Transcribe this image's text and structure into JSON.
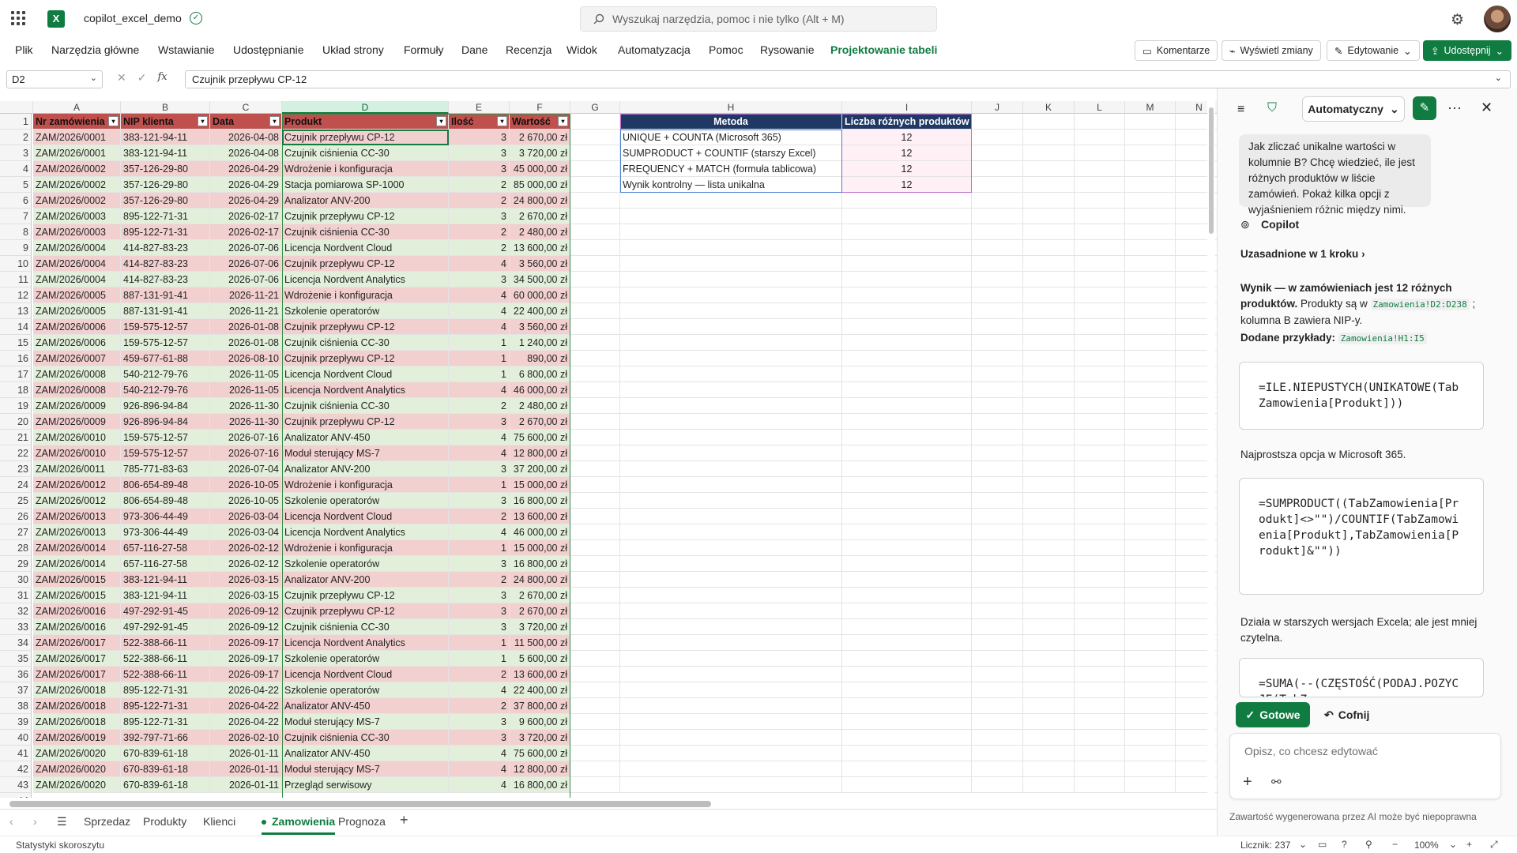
{
  "app": {
    "doc_title": "copilot_excel_demo",
    "search_placeholder": "Wyszukaj narzędzia, pomoc i nie tylko (Alt + M)"
  },
  "menu": [
    "Plik",
    "Narzędzia główne",
    "Wstawianie",
    "Udostępnianie",
    "Układ strony",
    "Formuły",
    "Dane",
    "Recenzja",
    "Widok",
    "Automatyzacja",
    "Pomoc",
    "Rysowanie",
    "Projektowanie tabeli"
  ],
  "ribbon_buttons": {
    "comments": "Komentarze",
    "changes": "Wyświetl zmiany",
    "editing": "Edytowanie",
    "share": "Udostępnij"
  },
  "formula_bar": {
    "name_box": "D2",
    "formula": "Czujnik przepływu CP-12"
  },
  "columns": [
    "A",
    "B",
    "C",
    "D",
    "E",
    "F",
    "G",
    "H",
    "I",
    "J",
    "K",
    "L",
    "M",
    "N"
  ],
  "table_headers": [
    "Nr zamówienia",
    "NIP klienta",
    "Data",
    "Produkt",
    "Ilość",
    "Wartość"
  ],
  "rows": [
    [
      "ZAM/2026/0001",
      "383-121-94-11",
      "2026-04-08",
      "Czujnik przepływu CP-12",
      "3",
      "2 670,00 zł"
    ],
    [
      "ZAM/2026/0001",
      "383-121-94-11",
      "2026-04-08",
      "Czujnik ciśnienia CC-30",
      "3",
      "3 720,00 zł"
    ],
    [
      "ZAM/2026/0002",
      "357-126-29-80",
      "2026-04-29",
      "Wdrożenie i konfiguracja",
      "3",
      "45 000,00 zł"
    ],
    [
      "ZAM/2026/0002",
      "357-126-29-80",
      "2026-04-29",
      "Stacja pomiarowa SP-1000",
      "2",
      "85 000,00 zł"
    ],
    [
      "ZAM/2026/0002",
      "357-126-29-80",
      "2026-04-29",
      "Analizator ANV-200",
      "2",
      "24 800,00 zł"
    ],
    [
      "ZAM/2026/0003",
      "895-122-71-31",
      "2026-02-17",
      "Czujnik przepływu CP-12",
      "3",
      "2 670,00 zł"
    ],
    [
      "ZAM/2026/0003",
      "895-122-71-31",
      "2026-02-17",
      "Czujnik ciśnienia CC-30",
      "2",
      "2 480,00 zł"
    ],
    [
      "ZAM/2026/0004",
      "414-827-83-23",
      "2026-07-06",
      "Licencja Nordvent Cloud",
      "2",
      "13 600,00 zł"
    ],
    [
      "ZAM/2026/0004",
      "414-827-83-23",
      "2026-07-06",
      "Czujnik przepływu CP-12",
      "4",
      "3 560,00 zł"
    ],
    [
      "ZAM/2026/0004",
      "414-827-83-23",
      "2026-07-06",
      "Licencja Nordvent Analytics",
      "3",
      "34 500,00 zł"
    ],
    [
      "ZAM/2026/0005",
      "887-131-91-41",
      "2026-11-21",
      "Wdrożenie i konfiguracja",
      "4",
      "60 000,00 zł"
    ],
    [
      "ZAM/2026/0005",
      "887-131-91-41",
      "2026-11-21",
      "Szkolenie operatorów",
      "4",
      "22 400,00 zł"
    ],
    [
      "ZAM/2026/0006",
      "159-575-12-57",
      "2026-01-08",
      "Czujnik przepływu CP-12",
      "4",
      "3 560,00 zł"
    ],
    [
      "ZAM/2026/0006",
      "159-575-12-57",
      "2026-01-08",
      "Czujnik ciśnienia CC-30",
      "1",
      "1 240,00 zł"
    ],
    [
      "ZAM/2026/0007",
      "459-677-61-88",
      "2026-08-10",
      "Czujnik przepływu CP-12",
      "1",
      "890,00 zł"
    ],
    [
      "ZAM/2026/0008",
      "540-212-79-76",
      "2026-11-05",
      "Licencja Nordvent Cloud",
      "1",
      "6 800,00 zł"
    ],
    [
      "ZAM/2026/0008",
      "540-212-79-76",
      "2026-11-05",
      "Licencja Nordvent Analytics",
      "4",
      "46 000,00 zł"
    ],
    [
      "ZAM/2026/0009",
      "926-896-94-84",
      "2026-11-30",
      "Czujnik ciśnienia CC-30",
      "2",
      "2 480,00 zł"
    ],
    [
      "ZAM/2026/0009",
      "926-896-94-84",
      "2026-11-30",
      "Czujnik przepływu CP-12",
      "3",
      "2 670,00 zł"
    ],
    [
      "ZAM/2026/0010",
      "159-575-12-57",
      "2026-07-16",
      "Analizator ANV-450",
      "4",
      "75 600,00 zł"
    ],
    [
      "ZAM/2026/0010",
      "159-575-12-57",
      "2026-07-16",
      "Moduł sterujący MS-7",
      "4",
      "12 800,00 zł"
    ],
    [
      "ZAM/2026/0011",
      "785-771-83-63",
      "2026-07-04",
      "Analizator ANV-200",
      "3",
      "37 200,00 zł"
    ],
    [
      "ZAM/2026/0012",
      "806-654-89-48",
      "2026-10-05",
      "Wdrożenie i konfiguracja",
      "1",
      "15 000,00 zł"
    ],
    [
      "ZAM/2026/0012",
      "806-654-89-48",
      "2026-10-05",
      "Szkolenie operatorów",
      "3",
      "16 800,00 zł"
    ],
    [
      "ZAM/2026/0013",
      "973-306-44-49",
      "2026-03-04",
      "Licencja Nordvent Cloud",
      "2",
      "13 600,00 zł"
    ],
    [
      "ZAM/2026/0013",
      "973-306-44-49",
      "2026-03-04",
      "Licencja Nordvent Analytics",
      "4",
      "46 000,00 zł"
    ],
    [
      "ZAM/2026/0014",
      "657-116-27-58",
      "2026-02-12",
      "Wdrożenie i konfiguracja",
      "1",
      "15 000,00 zł"
    ],
    [
      "ZAM/2026/0014",
      "657-116-27-58",
      "2026-02-12",
      "Szkolenie operatorów",
      "3",
      "16 800,00 zł"
    ],
    [
      "ZAM/2026/0015",
      "383-121-94-11",
      "2026-03-15",
      "Analizator ANV-200",
      "2",
      "24 800,00 zł"
    ],
    [
      "ZAM/2026/0015",
      "383-121-94-11",
      "2026-03-15",
      "Czujnik przepływu CP-12",
      "3",
      "2 670,00 zł"
    ],
    [
      "ZAM/2026/0016",
      "497-292-91-45",
      "2026-09-12",
      "Czujnik przepływu CP-12",
      "3",
      "2 670,00 zł"
    ],
    [
      "ZAM/2026/0016",
      "497-292-91-45",
      "2026-09-12",
      "Czujnik ciśnienia CC-30",
      "3",
      "3 720,00 zł"
    ],
    [
      "ZAM/2026/0017",
      "522-388-66-11",
      "2026-09-17",
      "Licencja Nordvent Analytics",
      "1",
      "11 500,00 zł"
    ],
    [
      "ZAM/2026/0017",
      "522-388-66-11",
      "2026-09-17",
      "Szkolenie operatorów",
      "1",
      "5 600,00 zł"
    ],
    [
      "ZAM/2026/0017",
      "522-388-66-11",
      "2026-09-17",
      "Licencja Nordvent Cloud",
      "2",
      "13 600,00 zł"
    ],
    [
      "ZAM/2026/0018",
      "895-122-71-31",
      "2026-04-22",
      "Szkolenie operatorów",
      "4",
      "22 400,00 zł"
    ],
    [
      "ZAM/2026/0018",
      "895-122-71-31",
      "2026-04-22",
      "Analizator ANV-450",
      "2",
      "37 800,00 zł"
    ],
    [
      "ZAM/2026/0018",
      "895-122-71-31",
      "2026-04-22",
      "Moduł sterujący MS-7",
      "3",
      "9 600,00 zł"
    ],
    [
      "ZAM/2026/0019",
      "392-797-71-66",
      "2026-02-10",
      "Czujnik ciśnienia CC-30",
      "3",
      "3 720,00 zł"
    ],
    [
      "ZAM/2026/0020",
      "670-839-61-18",
      "2026-01-11",
      "Analizator ANV-450",
      "4",
      "75 600,00 zł"
    ],
    [
      "ZAM/2026/0020",
      "670-839-61-18",
      "2026-01-11",
      "Moduł sterujący MS-7",
      "4",
      "12 800,00 zł"
    ],
    [
      "ZAM/2026/0020",
      "670-839-61-18",
      "2026-01-11",
      "Przegląd serwisowy",
      "4",
      "16 800,00 zł"
    ]
  ],
  "summary": {
    "headers": [
      "Metoda",
      "Liczba różnych produktów"
    ],
    "rows": [
      [
        "UNIQUE + COUNTA (Microsoft 365)",
        "12"
      ],
      [
        "SUMPRODUCT + COUNTIF (starszy Excel)",
        "12"
      ],
      [
        "FREQUENCY + MATCH (formuła tablicowa)",
        "12"
      ],
      [
        "Wynik kontrolny — lista unikalna",
        "12"
      ]
    ]
  },
  "sheet_tabs": [
    "Sprzedaz",
    "Produkty",
    "Klienci",
    "Zamowienia",
    "Prognoza"
  ],
  "active_tab": "Zamowienia",
  "status": {
    "left": "Statystyki skoroszytu",
    "count": "Licznik: 237",
    "zoom": "100%"
  },
  "copilot": {
    "mode": "Automatyczny",
    "user_message": "Jak zliczać unikalne wartości w kolumnie B? Chcę wiedzieć, ile jest różnych produktów w liście zamówień. Pokaż kilka opcji z wyjaśnieniem różnic między nimi.",
    "sender": "Copilot",
    "grounded": "Uzasadnione w 1 kroku",
    "result_bold": "Wynik — w zamówieniach jest 12 różnych produktów.",
    "result_rest1": " Produkty są w ",
    "result_code1": "Zamowienia!D2:D238",
    "result_rest2": " ; kolumna B zawiera NIP-y.",
    "added_label": "Dodane przykłady:",
    "added_code": "Zamowienia!H1:I5",
    "code1": "=ILE.NIEPUSTYCH(UNIKATOWE(TabZamowienia[Produkt]))",
    "note1": "Najprostsza opcja w Microsoft 365.",
    "code2": "=SUMPRODUCT((TabZamowienia[Produkt]<>\"\")/COUNTIF(TabZamowienia[Produkt],TabZamowienia[Produkt]&\"\"))",
    "note2": "Działa w starszych wersjach Excela; ale jest mniej czytelna.",
    "code3": "=SUMA(--(CZĘSTOŚĆ(PODAJ.POZYCJĘ(TabZa",
    "done": "Gotowe",
    "undo": "Cofnij",
    "input_placeholder": "Opisz, co chcesz edytować",
    "disclaimer": "Zawartość wygenerowana przez AI może być niepoprawna"
  },
  "colors": {
    "accent": "#107c41",
    "header_red": "#c0504d",
    "row_red": "#f2d0cf",
    "row_green": "#e2efda",
    "summary_header": "#1f3864"
  }
}
